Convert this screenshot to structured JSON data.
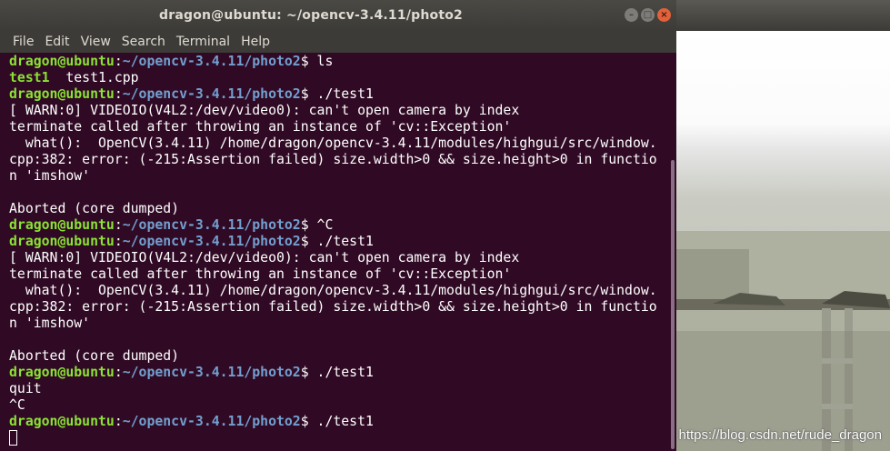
{
  "window": {
    "title": "dragon@ubuntu: ~/opencv-3.4.11/photo2"
  },
  "menu": [
    "File",
    "Edit",
    "View",
    "Search",
    "Terminal",
    "Help"
  ],
  "terminal": {
    "lines": [
      {
        "segments": [
          {
            "t": "dragon@ubuntu",
            "c": "user"
          },
          {
            "t": ":",
            "c": "plain"
          },
          {
            "t": "~/opencv-3.4.11/photo2",
            "c": "path"
          },
          {
            "t": "$ ls",
            "c": "plain"
          }
        ]
      },
      {
        "segments": [
          {
            "t": "test1",
            "c": "exec"
          },
          {
            "t": "  test1.cpp",
            "c": "plain"
          }
        ]
      },
      {
        "segments": [
          {
            "t": "dragon@ubuntu",
            "c": "user"
          },
          {
            "t": ":",
            "c": "plain"
          },
          {
            "t": "~/opencv-3.4.11/photo2",
            "c": "path"
          },
          {
            "t": "$ ./test1",
            "c": "plain"
          }
        ]
      },
      {
        "segments": [
          {
            "t": "[ WARN:0] VIDEOIO(V4L2:/dev/video0): can't open camera by index",
            "c": "plain"
          }
        ]
      },
      {
        "segments": [
          {
            "t": "terminate called after throwing an instance of 'cv::Exception'",
            "c": "plain"
          }
        ]
      },
      {
        "segments": [
          {
            "t": "  what():  OpenCV(3.4.11) /home/dragon/opencv-3.4.11/modules/highgui/src/window.",
            "c": "plain"
          }
        ]
      },
      {
        "segments": [
          {
            "t": "cpp:382: error: (-215:Assertion failed) size.width>0 && size.height>0 in functio",
            "c": "plain"
          }
        ]
      },
      {
        "segments": [
          {
            "t": "n 'imshow'",
            "c": "plain"
          }
        ]
      },
      {
        "segments": []
      },
      {
        "segments": [
          {
            "t": "Aborted (core dumped)",
            "c": "plain"
          }
        ]
      },
      {
        "segments": [
          {
            "t": "dragon@ubuntu",
            "c": "user"
          },
          {
            "t": ":",
            "c": "plain"
          },
          {
            "t": "~/opencv-3.4.11/photo2",
            "c": "path"
          },
          {
            "t": "$ ^C",
            "c": "plain"
          }
        ]
      },
      {
        "segments": [
          {
            "t": "dragon@ubuntu",
            "c": "user"
          },
          {
            "t": ":",
            "c": "plain"
          },
          {
            "t": "~/opencv-3.4.11/photo2",
            "c": "path"
          },
          {
            "t": "$ ./test1",
            "c": "plain"
          }
        ]
      },
      {
        "segments": [
          {
            "t": "[ WARN:0] VIDEOIO(V4L2:/dev/video0): can't open camera by index",
            "c": "plain"
          }
        ]
      },
      {
        "segments": [
          {
            "t": "terminate called after throwing an instance of 'cv::Exception'",
            "c": "plain"
          }
        ]
      },
      {
        "segments": [
          {
            "t": "  what():  OpenCV(3.4.11) /home/dragon/opencv-3.4.11/modules/highgui/src/window.",
            "c": "plain"
          }
        ]
      },
      {
        "segments": [
          {
            "t": "cpp:382: error: (-215:Assertion failed) size.width>0 && size.height>0 in functio",
            "c": "plain"
          }
        ]
      },
      {
        "segments": [
          {
            "t": "n 'imshow'",
            "c": "plain"
          }
        ]
      },
      {
        "segments": []
      },
      {
        "segments": [
          {
            "t": "Aborted (core dumped)",
            "c": "plain"
          }
        ]
      },
      {
        "segments": [
          {
            "t": "dragon@ubuntu",
            "c": "user"
          },
          {
            "t": ":",
            "c": "plain"
          },
          {
            "t": "~/opencv-3.4.11/photo2",
            "c": "path"
          },
          {
            "t": "$ ./test1",
            "c": "plain"
          }
        ]
      },
      {
        "segments": [
          {
            "t": "quit",
            "c": "plain"
          }
        ]
      },
      {
        "segments": [
          {
            "t": "^C",
            "c": "plain"
          }
        ]
      },
      {
        "segments": [
          {
            "t": "dragon@ubuntu",
            "c": "user"
          },
          {
            "t": ":",
            "c": "plain"
          },
          {
            "t": "~/opencv-3.4.11/photo2",
            "c": "path"
          },
          {
            "t": "$ ./test1",
            "c": "plain"
          }
        ]
      },
      {
        "segments": [
          {
            "t": "",
            "c": "cursor"
          }
        ]
      }
    ]
  },
  "titlebar_buttons": [
    {
      "name": "minimize-button",
      "glyph": "–"
    },
    {
      "name": "maximize-button",
      "glyph": "□"
    },
    {
      "name": "close-button",
      "glyph": "×"
    }
  ],
  "watermark": "https://blog.csdn.net/rude_dragon",
  "colors": {
    "terminal_bg": "#300a24",
    "prompt_user": "#8ae234",
    "prompt_path": "#729fcf",
    "titlebar": "#3c3b37",
    "close_button": "#e2613a"
  }
}
